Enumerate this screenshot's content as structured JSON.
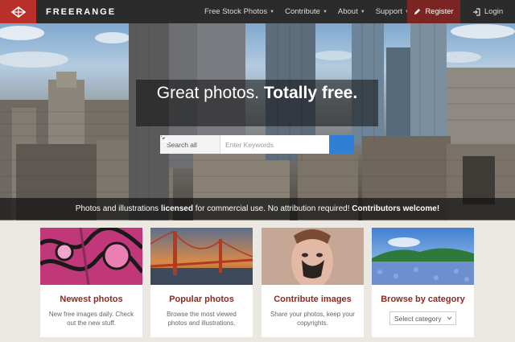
{
  "nav": {
    "brand": "FREERANGE",
    "items": [
      {
        "label": "Free Stock Photos"
      },
      {
        "label": "Contribute"
      },
      {
        "label": "About"
      },
      {
        "label": "Support"
      }
    ],
    "register": "Register",
    "login": "Login",
    "colors": {
      "bar": "#2b2b2b",
      "logo": "#b9302b",
      "register": "#7b2523"
    }
  },
  "hero": {
    "headline_regular": "Great photos.",
    "headline_bold": "Totally free.",
    "search": {
      "category": "Search all",
      "placeholder": "Enter Keywords",
      "button_icon": "search-icon"
    },
    "tagline": {
      "part1": "Photos and illustrations ",
      "bold1": "licensed",
      "part2": " for commercial use. No attribution required! ",
      "bold2": "Contributors welcome!"
    }
  },
  "cards": [
    {
      "title": "Newest photos",
      "desc": "New free images daily. Check out the new stuff."
    },
    {
      "title": "Popular photos",
      "desc": "Browse the most viewed photos and illustrations."
    },
    {
      "title": "Contribute images",
      "desc": "Share your photos, keep your copyrights."
    },
    {
      "title": "Browse by category",
      "select": "Select category"
    }
  ]
}
